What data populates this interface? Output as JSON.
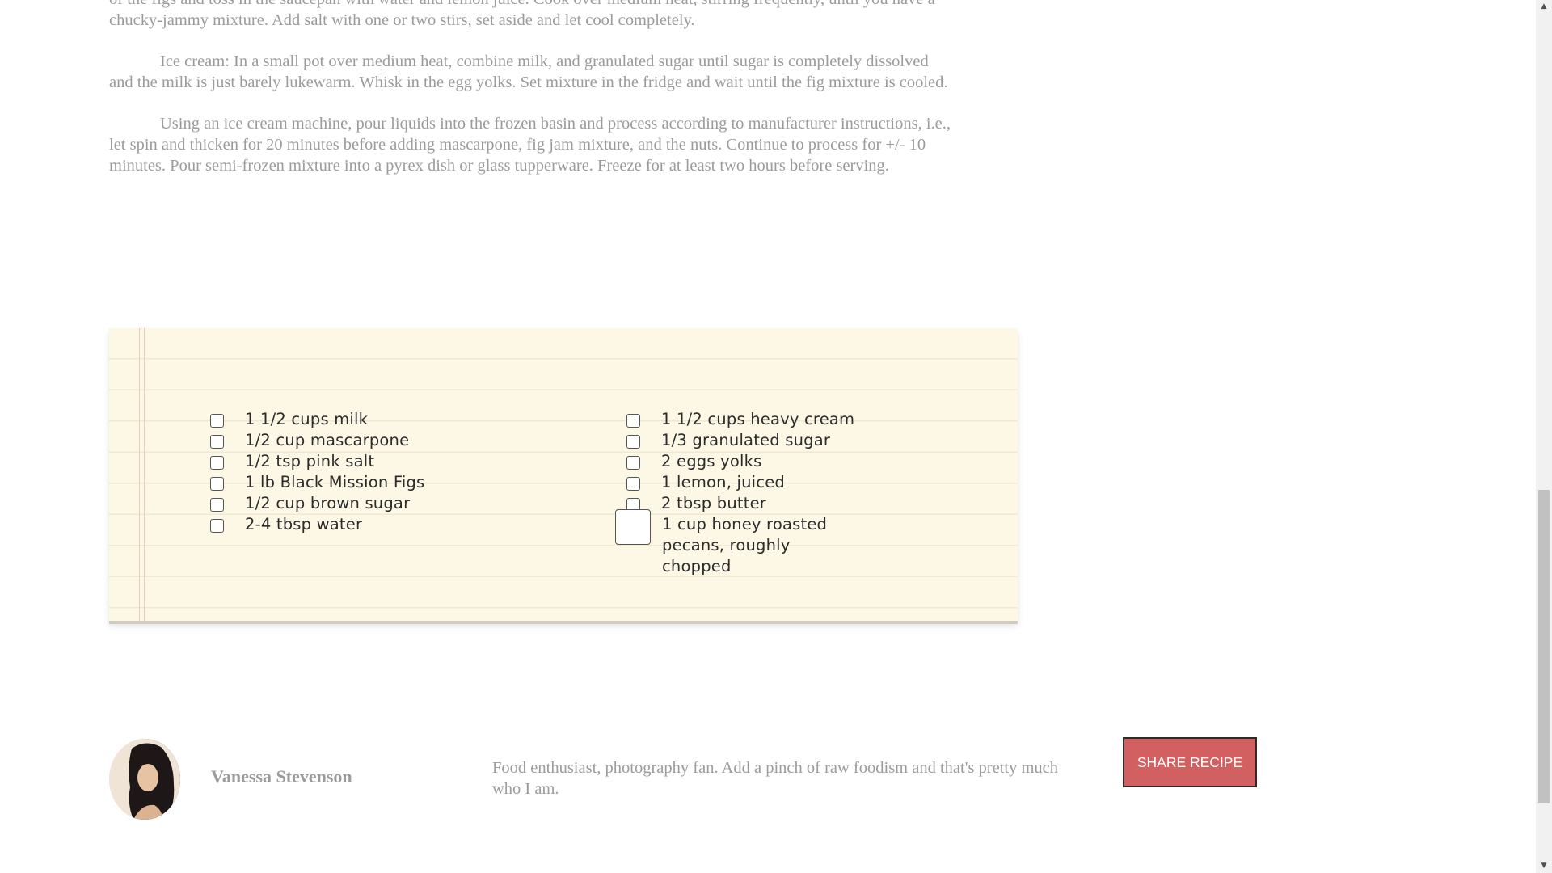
{
  "instructions": {
    "paragraphs": [
      "of the figs and toss in the saucepan with water and lemon juice. Cook over medium heat, stirring frequently, until you have a chucky-jammy mixture. Add salt with one or two stirs, set aside and let cool completely.",
      "Ice cream: In a small pot over medium heat, combine milk, and granulated sugar until sugar is completely dissolved and the milk is just barely lukewarm. Whisk in the egg yolks. Set mixture in the fridge and wait until the fig mixture is cooled.",
      "Using an ice cream machine, pour liquids into the frozen basin and process according to manufacturer instructions, i.e., let spin and thicken for 20 minutes before adding mascarpone, fig jam mixture, and the nuts. Continue to process for +/- 10 minutes. Pour semi-frozen mixture into a pyrex dish or glass tupperware. Freeze for at least two hours before serving."
    ]
  },
  "ingredients": {
    "left": [
      "1 1/2 cups milk",
      "1/2 cup mascarpone",
      "1/2 tsp pink salt",
      "1 lb Black Mission Figs",
      "1/2 cup brown sugar",
      "2-4 tbsp water"
    ],
    "right": [
      "1 1/2 cups heavy cream",
      "1/3 granulated sugar",
      "2 eggs yolks",
      "1 lemon, juiced",
      "2 tbsp butter",
      "1 cup honey roasted pecans, roughly chopped"
    ]
  },
  "author": {
    "name": "Vanessa Stevenson",
    "bio": "Food enthusiast, photography fan. Add a pinch of raw foodism and that's pretty much who I am."
  },
  "share": {
    "label": "SHARE RECIPE"
  },
  "colors": {
    "share_button": "#d36060",
    "notepad": "#fdf7e6",
    "body_text": "#9b9b9b"
  },
  "icons": {
    "scroll_up": "scroll-up-arrow-icon",
    "scroll_down": "scroll-down-arrow-icon",
    "checkbox": "checkbox-icon"
  }
}
